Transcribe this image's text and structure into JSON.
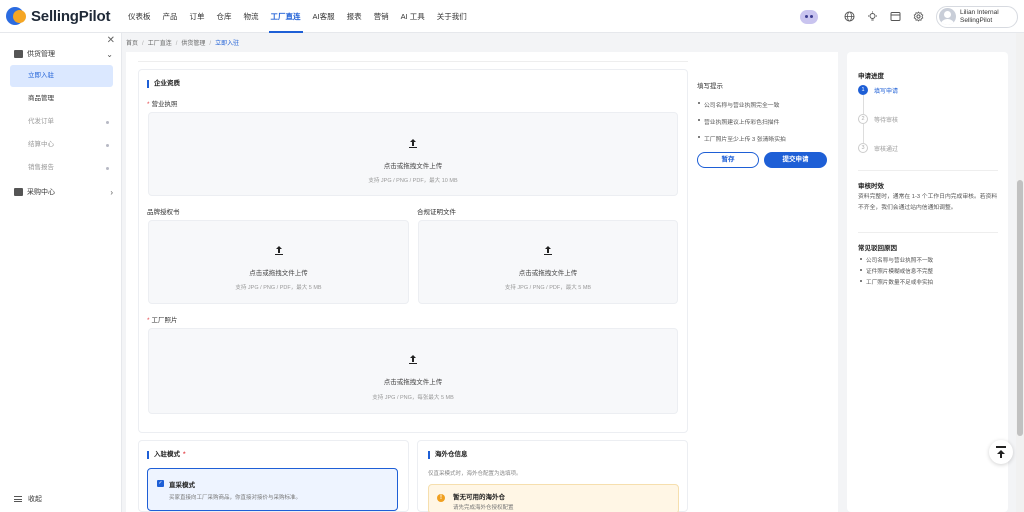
{
  "app": {
    "logo_text": "SellingPilot"
  },
  "nav": {
    "items": [
      "仪表板",
      "产品",
      "订单",
      "仓库",
      "物流",
      "工厂直连",
      "AI客服",
      "报表",
      "营销",
      "AI 工具",
      "关于我们"
    ],
    "active": "工厂直连"
  },
  "user": {
    "line1": "Lilian Internal",
    "line2": "SellingPilot"
  },
  "sidebar": {
    "group1": "供货管理",
    "items": [
      "立即入驻",
      "商品管理",
      "代发订单",
      "结算中心",
      "销售报告"
    ],
    "group2": "采购中心",
    "footer": "收起"
  },
  "breadcrumb": [
    "首页",
    "工厂直连",
    "供货管理",
    "立即入驻"
  ],
  "form": {
    "section_title": "企业资质",
    "license_label": "营业执照",
    "license_upload": "点击或拖拽文件上传",
    "license_hint": "支持 JPG / PNG / PDF，最大 10 MB",
    "brand_label": "品牌授权书",
    "brand_upload": "点击或拖拽文件上传",
    "brand_hint": "支持 JPG / PNG / PDF，最大 5 MB",
    "cert_label": "合规证明文件",
    "cert_upload": "点击或拖拽文件上传",
    "cert_hint": "支持 JPG / PNG / PDF，最大 5 MB",
    "factory_label": "工厂照片",
    "factory_upload": "点击或拖拽文件上传",
    "factory_hint": "支持 JPG / PNG，每张最大 5 MB"
  },
  "tips": {
    "title": "填写提示",
    "items": [
      "公司名称与营业执照完全一致",
      "营业执照建议上传彩色扫描件",
      "工厂照片至少上传 3 张清晰实拍"
    ],
    "save": "暂存",
    "submit": "提交申请"
  },
  "mode": {
    "title": "入驻模式",
    "option_title": "直采模式",
    "option_desc": "买家直接向工厂采购商品，你直接对接价与采购标准。"
  },
  "warehouse": {
    "title": "海外仓信息",
    "hint": "仅直采模式时，海外仓配置为选填项。",
    "alert_title": "暂无可用的海外仓",
    "alert_desc": "请先完成海外仓授权配置"
  },
  "progress": {
    "title": "申请进度",
    "steps": [
      {
        "num": "1",
        "label": "填写申请"
      },
      {
        "num": "2",
        "label": "等待审核"
      },
      {
        "num": "3",
        "label": "审核通过"
      }
    ]
  },
  "review": {
    "title": "审核时效",
    "text": "资料完整时，通常在 1-3 个工作日内完成审核。若资料不齐全，我们会通过站内信通知调整。"
  },
  "reasons": {
    "title": "常见驳回原因",
    "items": [
      "公司名称与营业执照不一致",
      "证件照片模糊或信息不完整",
      "工厂照片数量不足或非实拍"
    ]
  },
  "colors": {
    "accent": "#1e5fd6",
    "warning": "#f0a020"
  }
}
